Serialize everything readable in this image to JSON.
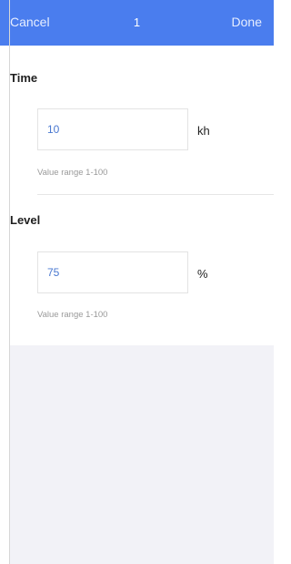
{
  "nav": {
    "cancel_label": "Cancel",
    "title": "1",
    "done_label": "Done",
    "bar_color": "#4a7dee"
  },
  "fields": {
    "time": {
      "label": "Time",
      "value": "10",
      "unit": "kh",
      "hint": "Value range 1-100"
    },
    "level": {
      "label": "Level",
      "value": "75",
      "unit": "%",
      "hint": "Value range 1-100"
    }
  }
}
